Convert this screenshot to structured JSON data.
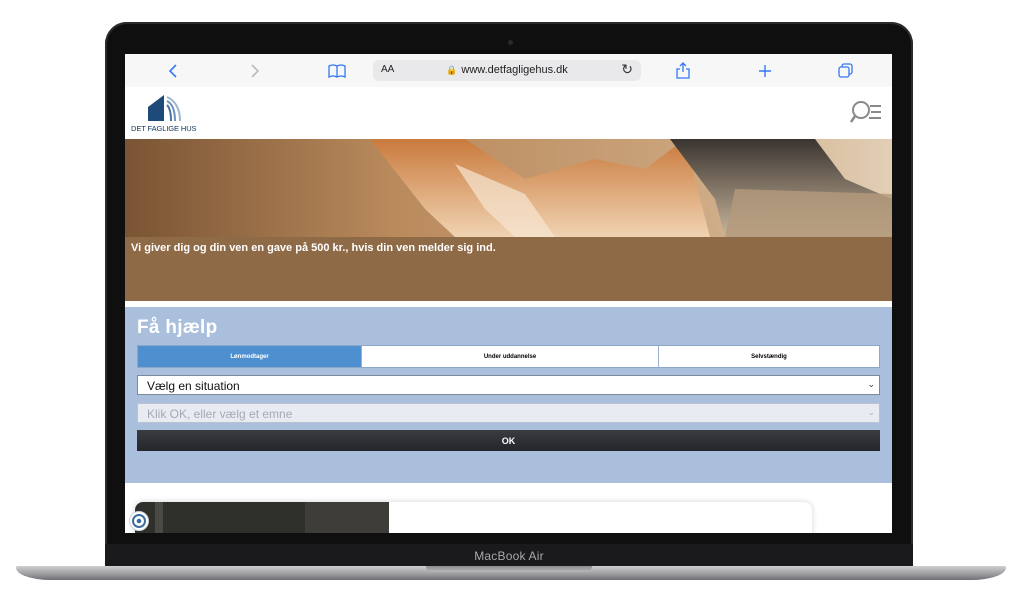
{
  "device": {
    "label": "MacBook Air"
  },
  "browser": {
    "text_size_label": "AA",
    "url": "www.detfagligehus.dk",
    "icons": [
      "back-icon",
      "forward-icon",
      "bookmarks-icon",
      "lock-icon",
      "reload-icon",
      "share-icon",
      "new-tab-icon",
      "tabs-icon"
    ]
  },
  "site": {
    "logo_text": "DET FAGLIGE HUS",
    "brand_color": "#1d4a78",
    "hero": {
      "caption": "Vi giver dig og din ven en gave på 500 kr., hvis din ven melder sig ind.",
      "bg_color": "#8e6a46"
    },
    "help": {
      "title": "Få hjælp",
      "bg_color": "#a9bfdb",
      "tabs": [
        {
          "label": "Lønmodtager",
          "active": true
        },
        {
          "label": "Under uddannelse",
          "active": false
        },
        {
          "label": "Selvstændig",
          "active": false
        }
      ],
      "situation_select": {
        "value": "Vælg en situation"
      },
      "topic_select": {
        "value": "Klik OK, eller vælg et emne"
      },
      "ok_label": "OK"
    }
  }
}
